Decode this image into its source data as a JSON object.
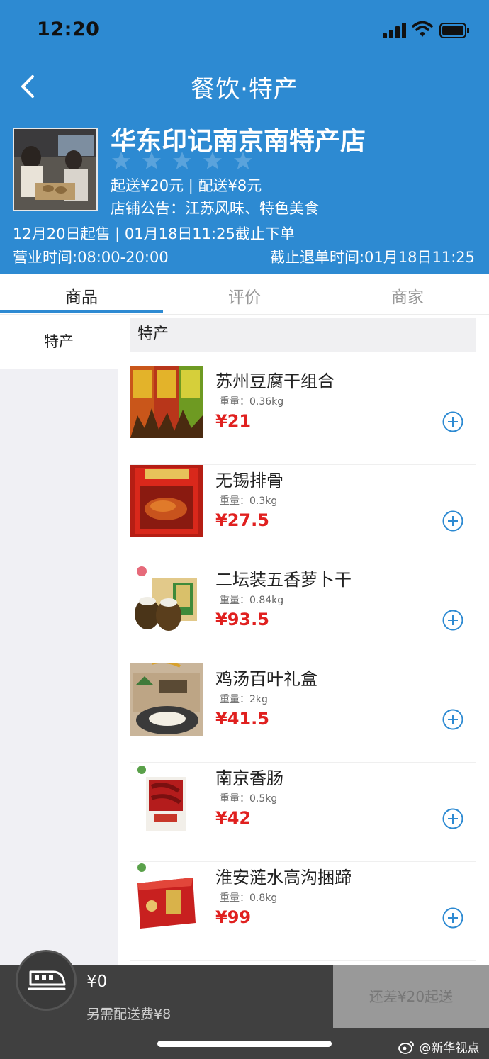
{
  "status_bar": {
    "time": "12:20"
  },
  "nav": {
    "title": "餐饮·特产"
  },
  "shop": {
    "name": "华东印记南京南特产店",
    "fee_text": "起送¥20元 | 配送¥8元",
    "notice": "店铺公告：江苏风味、特色美食",
    "sale_period": "12月20日起售 | 01月18日11:25截止下单",
    "hours": "营业时间:08:00-20:00",
    "refund_deadline": "截止退单时间:01月18日11:25",
    "rating_stars": 0
  },
  "tabs": [
    {
      "label": "商品",
      "active": true
    },
    {
      "label": "评价",
      "active": false
    },
    {
      "label": "商家",
      "active": false
    }
  ],
  "sidebar": {
    "items": [
      {
        "label": "特产"
      }
    ]
  },
  "section": {
    "title": "特产"
  },
  "products": [
    {
      "name": "苏州豆腐干组合",
      "weight": "重量：0.36kg",
      "price": "¥21"
    },
    {
      "name": "无锡排骨",
      "weight": "重量：0.3kg",
      "price": "¥27.5"
    },
    {
      "name": "二坛装五香萝卜干",
      "weight": "重量：0.84kg",
      "price": "¥93.5"
    },
    {
      "name": "鸡汤百叶礼盒",
      "weight": "重量：2kg",
      "price": "¥41.5"
    },
    {
      "name": "南京香肠",
      "weight": "重量：0.5kg",
      "price": "¥42"
    },
    {
      "name": "淮安涟水高沟捆蹄",
      "weight": "重量：0.8kg",
      "price": "¥99"
    }
  ],
  "cart": {
    "total": "¥0",
    "delivery_fee_note": "另需配送费¥8",
    "checkout_label": "还差¥20起送"
  },
  "watermark": "@新华视点",
  "colors": {
    "header": "#2d8ad2",
    "price": "#e0201f",
    "cart_bar": "#404040"
  },
  "icons": [
    "back-icon",
    "signal-icon",
    "wifi-icon",
    "battery-icon",
    "star-icon",
    "add-icon",
    "train-icon",
    "weibo-icon"
  ]
}
